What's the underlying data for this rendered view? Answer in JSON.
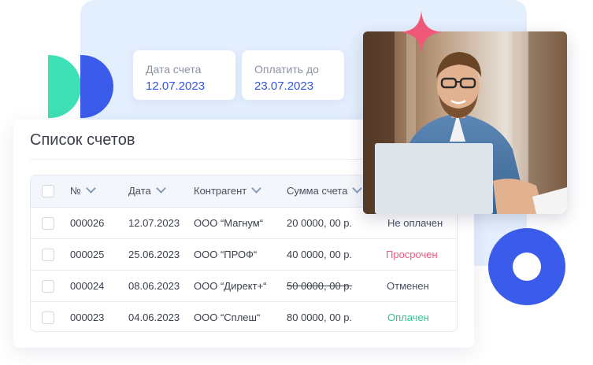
{
  "invoice_date": {
    "label": "Дата счета",
    "value": "12.07.2023"
  },
  "pay_until": {
    "label": "Оплатить до",
    "value": "23.07.2023"
  },
  "list": {
    "title": "Список счетов",
    "columns": [
      "№",
      "Дата",
      "Контрагент",
      "Сумма счета"
    ],
    "rows": [
      {
        "number": "000026",
        "date": "12.07.2023",
        "counterparty": "ООО “Магнум“",
        "amount": "20 0000, 00 р.",
        "status": "Не оплачен"
      },
      {
        "number": "000025",
        "date": "25.06.2023",
        "counterparty": "ООО “ПРОФ“",
        "amount": "40 0000, 00 р.",
        "status": "Просрочен"
      },
      {
        "number": "000024",
        "date": "08.06.2023",
        "counterparty": "ООО “Директ+“",
        "amount": "50 0000, 00 р.",
        "status": "Отменен"
      },
      {
        "number": "000023",
        "date": "04.06.2023",
        "counterparty": "ООО “Сплеш“",
        "amount": "80 0000, 00 р.",
        "status": "Оплачен"
      }
    ]
  },
  "colors": {
    "accent": "#3455db",
    "status_overdue": "#f0587a",
    "status_paid": "#2ec48e",
    "deco_green": "#3ee0b5",
    "deco_blue": "#3b5bea",
    "deco_star": "#f0587a"
  },
  "icons": [
    "checkbox-icon",
    "chevron-down-icon",
    "sparkle-star-icon"
  ]
}
